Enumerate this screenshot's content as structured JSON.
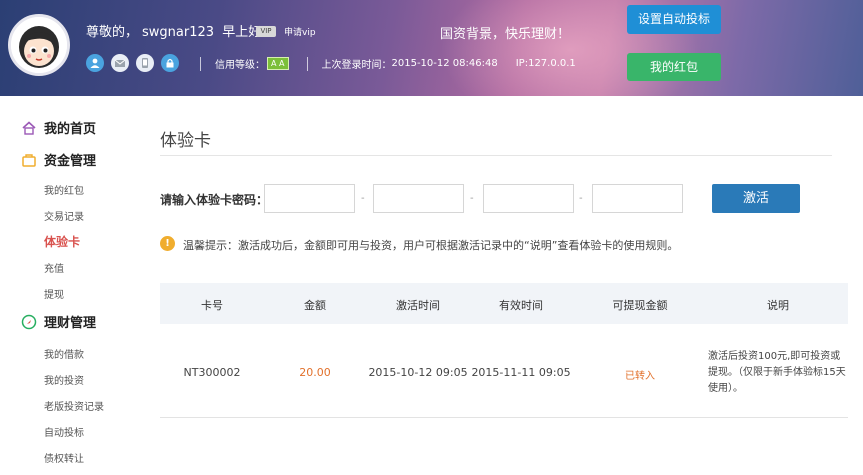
{
  "header": {
    "greeting_prefix": "尊敬的，",
    "username": "swgnar123",
    "greeting_suffix": "早上好！",
    "vip_badge": "VIP",
    "vip_apply": "申请vip",
    "slogan": "国资背景，快乐理财！",
    "credit_label": "信用等级：",
    "credit_value": "A A",
    "last_login_label": "上次登录时间：",
    "last_login_time": "2015-10-12 08:46:48",
    "ip_label": "IP:",
    "ip_value": "127.0.0.1",
    "auto_bid_button": "设置自动投标",
    "red_packet_button": "我的红包",
    "icons": [
      "user-icon",
      "mail-icon",
      "phone-icon",
      "lock-icon"
    ]
  },
  "sidebar": {
    "home": "我的首页",
    "fund_section": "资金管理",
    "fund_items": [
      "我的红包",
      "交易记录",
      "体验卡",
      "充值",
      "提现"
    ],
    "active_item": "体验卡",
    "finance_section": "理财管理",
    "finance_items": [
      "我的借款",
      "我的投资",
      "老版投资记录",
      "自动投标",
      "债权转让"
    ]
  },
  "main": {
    "title": "体验卡",
    "code_label": "请输入体验卡密码：",
    "code_inputs": [
      "",
      "",
      "",
      ""
    ],
    "dash": "-",
    "activate_button": "激活",
    "tip": "温馨提示：激活成功后，金额即可用与投资，用户可根据激活记录中的“说明”查看体验卡的使用规则。"
  },
  "table": {
    "headers": [
      "卡号",
      "金额",
      "激活时间",
      "有效时间",
      "可提现金额",
      "说明"
    ],
    "rows": [
      {
        "card_no": "NT300002",
        "amount": "20.00",
        "activated": "2015-10-12 09:05",
        "valid_until": "2015-11-11 09:05",
        "withdrawable": "已转入",
        "description": "激活后投资100元,即可投资或提现。（仅限于新手体验标15天使用）。"
      }
    ]
  },
  "colors": {
    "accent_blue": "#2a7ab8",
    "auto_bid_blue": "#1f8fd6",
    "red_packet_green": "#39b56a",
    "active_red": "#d9534f",
    "amount_orange": "#e2712c",
    "tip_yellow": "#f0ad2e"
  }
}
